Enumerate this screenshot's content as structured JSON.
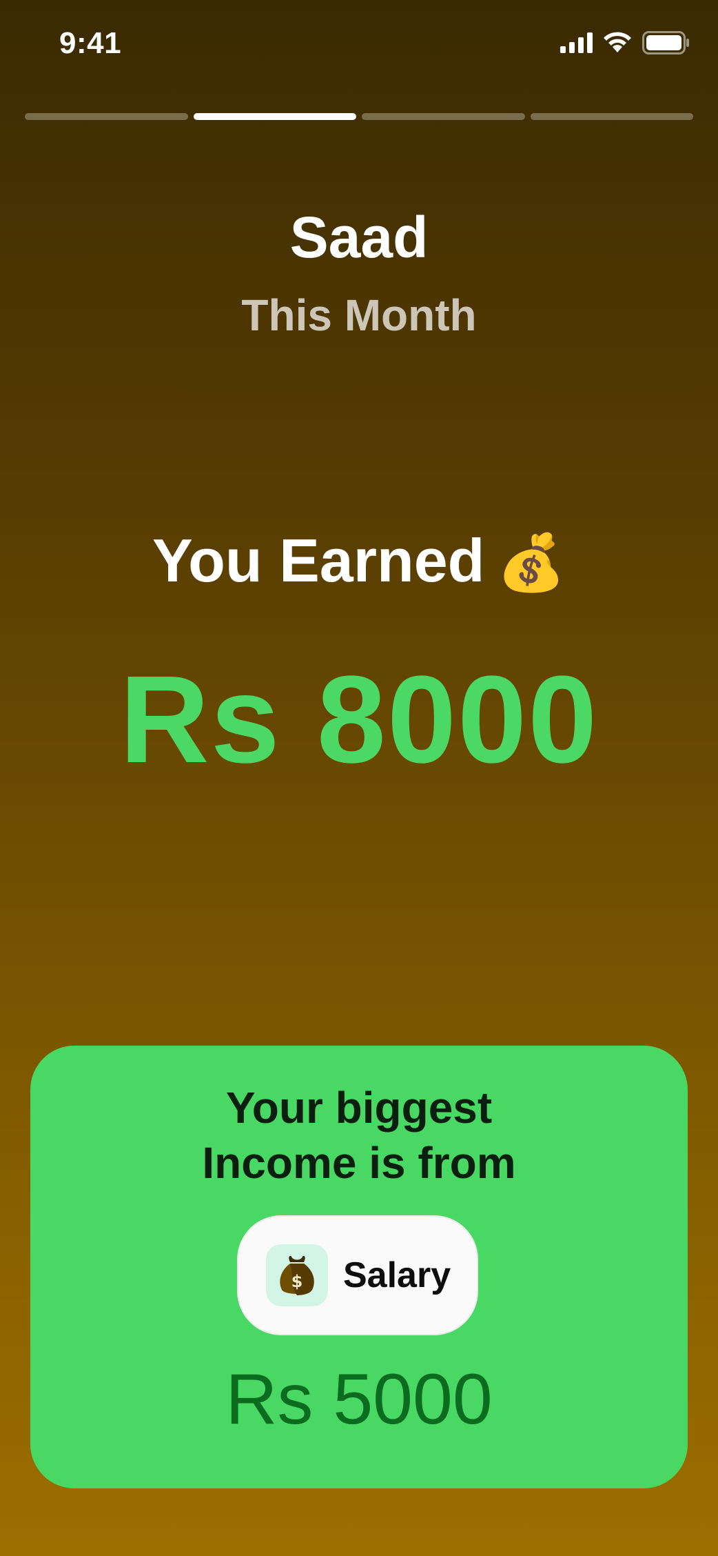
{
  "status_bar": {
    "time": "9:41"
  },
  "story": {
    "segments": 4,
    "active_segment": 2
  },
  "header": {
    "name": "Saad",
    "period": "This Month"
  },
  "summary": {
    "label": "You Earned",
    "emoji": "💰",
    "amount": "Rs 8000"
  },
  "card": {
    "title_line1": "Your biggest",
    "title_line2": "Income is from",
    "category_icon": "money-bag-icon",
    "category_label": "Salary",
    "category_amount": "Rs 5000"
  },
  "colors": {
    "accent_green": "#4ad865",
    "amount_green": "#4bd864",
    "card_amount_green": "#0b6b1f",
    "chip_icon_bg": "#d2f5e8"
  }
}
